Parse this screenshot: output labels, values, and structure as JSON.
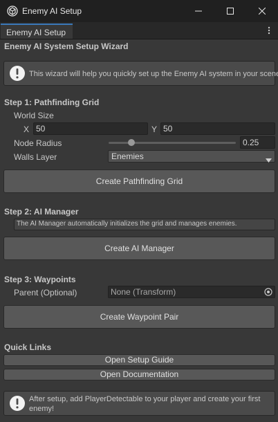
{
  "window": {
    "title": "Enemy AI Setup",
    "tab_label": "Enemy AI Setup"
  },
  "header": {
    "title": "Enemy AI System Setup Wizard",
    "intro_text": "This wizard will help you quickly set up the Enemy AI system in your scene."
  },
  "step1": {
    "title": "Step 1: Pathfinding Grid",
    "world_size_label": "World Size",
    "x_label": "X",
    "x_value": "50",
    "y_label": "Y",
    "y_value": "50",
    "node_radius_label": "Node Radius",
    "node_radius_value": "0.25",
    "node_radius_slider_fraction": 0.18,
    "walls_layer_label": "Walls Layer",
    "walls_layer_value": "Enemies",
    "create_button": "Create Pathfinding Grid"
  },
  "step2": {
    "title": "Step 2: AI Manager",
    "note": "The AI Manager automatically initializes the grid and manages enemies.",
    "create_button": "Create AI Manager"
  },
  "step3": {
    "title": "Step 3: Waypoints",
    "parent_label": "Parent (Optional)",
    "parent_value": "None (Transform)",
    "create_button": "Create Waypoint Pair"
  },
  "quick_links": {
    "title": "Quick Links",
    "setup_guide": "Open Setup Guide",
    "documentation": "Open Documentation"
  },
  "footer": {
    "tip_text": "After setup, add PlayerDetectable to your player and create your first enemy!"
  },
  "colors": {
    "background": "#383838",
    "titlebar": "#202020",
    "tab_accent": "#3a79bb",
    "button": "#585858",
    "field": "#2a2a2a"
  }
}
